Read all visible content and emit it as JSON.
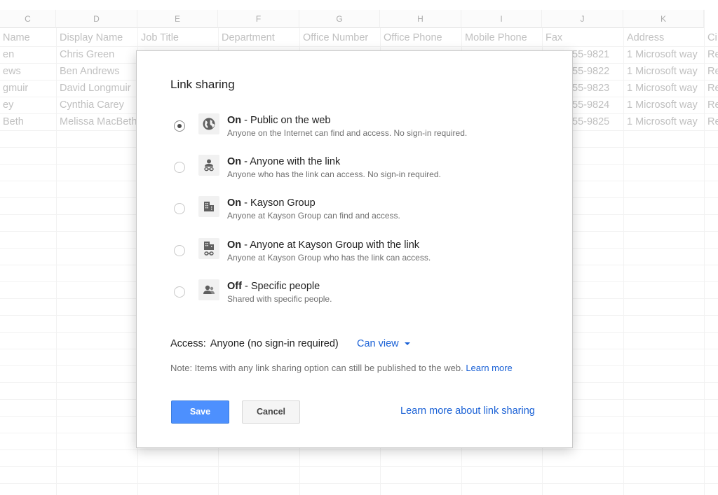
{
  "sheet": {
    "columns": [
      "C",
      "D",
      "E",
      "F",
      "G",
      "H",
      "I",
      "J",
      "K"
    ],
    "header_row": [
      "Name",
      "Display Name",
      "Job Title",
      "Department",
      "Office Number",
      "Office Phone",
      "Mobile Phone",
      "Fax",
      "Address",
      "Ci"
    ],
    "rows": [
      {
        "c": "en",
        "d": "Chris Green",
        "j": "55-9821",
        "k": "1 Microsoft way",
        "l": "Re"
      },
      {
        "c": "ews",
        "d": "Ben Andrews",
        "j": "55-9822",
        "k": "1 Microsoft way",
        "l": "Re"
      },
      {
        "c": "gmuir",
        "d": "David Longmuir",
        "j": "55-9823",
        "k": "1 Microsoft way",
        "l": "Re"
      },
      {
        "c": "ey",
        "d": "Cynthia Carey",
        "j": "55-9824",
        "k": "1 Microsoft way",
        "l": "Re"
      },
      {
        "c": "Beth",
        "d": "Melissa MacBeth",
        "j": "55-9825",
        "k": "1 Microsoft way",
        "l": "Re"
      }
    ]
  },
  "dialog": {
    "title": "Link sharing",
    "options": [
      {
        "strong": "On",
        "rest": " - Public on the web",
        "desc": "Anyone on the Internet can find and access. No sign-in required.",
        "icon": "globe-icon",
        "selected": true
      },
      {
        "strong": "On",
        "rest": " - Anyone with the link",
        "desc": "Anyone who has the link can access. No sign-in required.",
        "icon": "person-link-icon",
        "selected": false
      },
      {
        "strong": "On",
        "rest": " - Kayson Group",
        "desc": "Anyone at Kayson Group can find and access.",
        "icon": "building-icon",
        "selected": false
      },
      {
        "strong": "On",
        "rest": " - Anyone at Kayson Group with the link",
        "desc": "Anyone at Kayson Group who has the link can access.",
        "icon": "building-link-icon",
        "selected": false
      },
      {
        "strong": "Off",
        "rest": " - Specific people",
        "desc": "Shared with specific people.",
        "icon": "people-icon",
        "selected": false
      }
    ],
    "access_label": "Access:",
    "access_value": "Anyone (no sign-in required)",
    "permission": "Can view",
    "note_text": "Note: Items with any link sharing option can still be published to the web.",
    "note_link": "Learn more",
    "save_label": "Save",
    "cancel_label": "Cancel",
    "learn_more_label": "Learn more about link sharing"
  },
  "colors": {
    "accent": "#4d90fe",
    "link": "#1a61d6"
  }
}
